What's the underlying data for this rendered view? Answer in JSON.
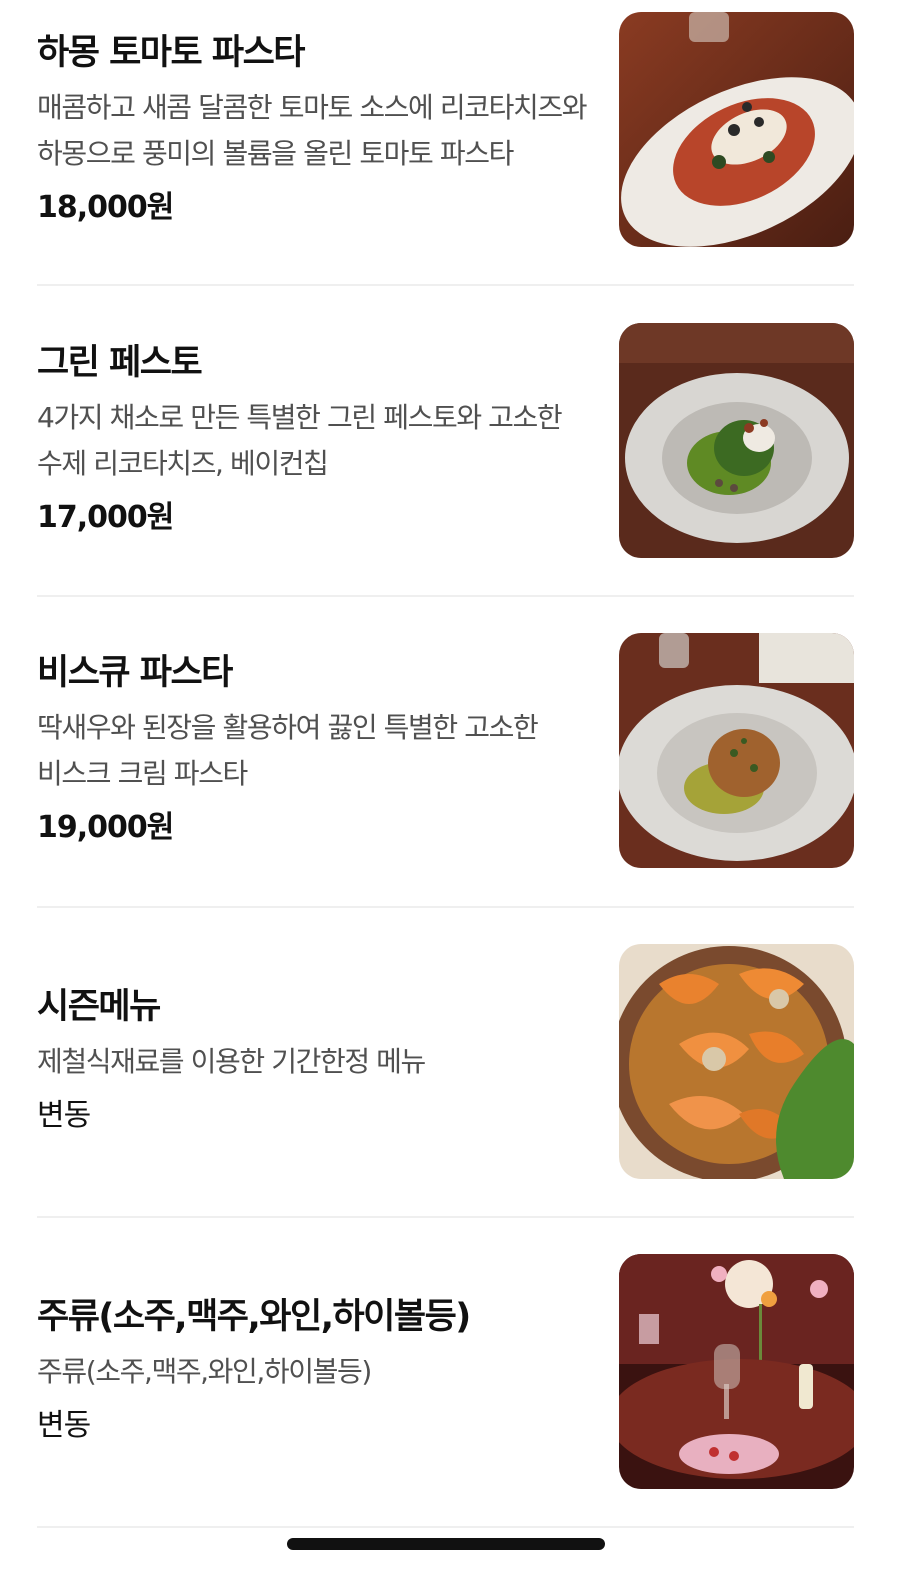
{
  "menu": {
    "items": [
      {
        "name": "하몽 토마토 파스타",
        "description": "매콤하고 새콤 달콤한 토마토 소스에 리코타치즈와 하몽으로 풍미의 볼륨을 올린 토마토 파스타",
        "price": "18,000원",
        "image_alt": "tomato-pasta-photo"
      },
      {
        "name": "그린 페스토",
        "description": "4가지 채소로 만든 특별한 그린 페스토와 고소한 수제 리코타치즈, 베이컨칩",
        "price": "17,000원",
        "image_alt": "green-pesto-photo"
      },
      {
        "name": "비스큐 파스타",
        "description": "딱새우와 된장을 활용하여 끓인 특별한 고소한 비스크 크림 파스타",
        "price": "19,000원",
        "image_alt": "bisque-pasta-photo"
      },
      {
        "name": "시즌메뉴",
        "description": "제철식재료를 이용한 기간한정 메뉴",
        "price": "변동",
        "image_alt": "season-menu-photo"
      },
      {
        "name": "주류(소주,맥주,와인,하이볼등)",
        "description": "주류(소주,맥주,와인,하이볼등)",
        "price": "변동",
        "image_alt": "drinks-photo"
      }
    ]
  }
}
